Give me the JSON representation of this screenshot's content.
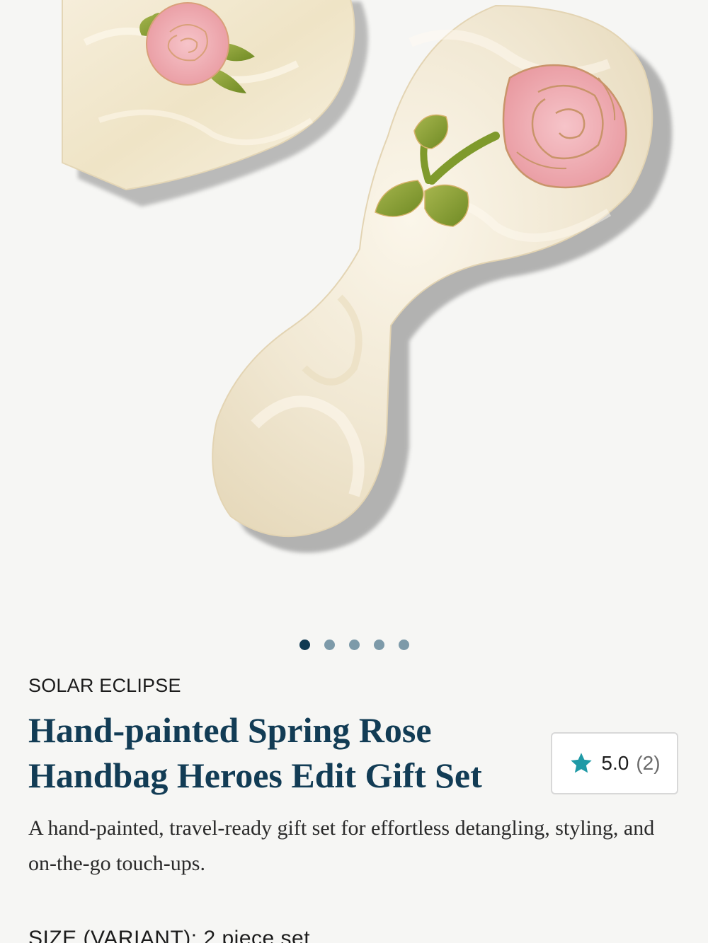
{
  "carousel": {
    "total_slides": 5,
    "active_index": 0
  },
  "product": {
    "brand": "SOLAR ECLIPSE",
    "title": "Hand-painted Spring Rose Handbag Heroes Edit Gift Set",
    "description": "A hand-painted, travel-ready gift set for effortless detangling, styling, and on-the-go touch-ups.",
    "rating": {
      "score": "5.0",
      "count": "(2)",
      "icon": "star-icon"
    },
    "size": {
      "label": "SIZE (VARIANT):",
      "value": "2 piece set"
    }
  },
  "colors": {
    "background": "#f6f6f4",
    "title": "#123c55",
    "dot_active": "#0f3a52",
    "dot_inactive": "#7d9aa9",
    "star": "#1f9aa6"
  }
}
